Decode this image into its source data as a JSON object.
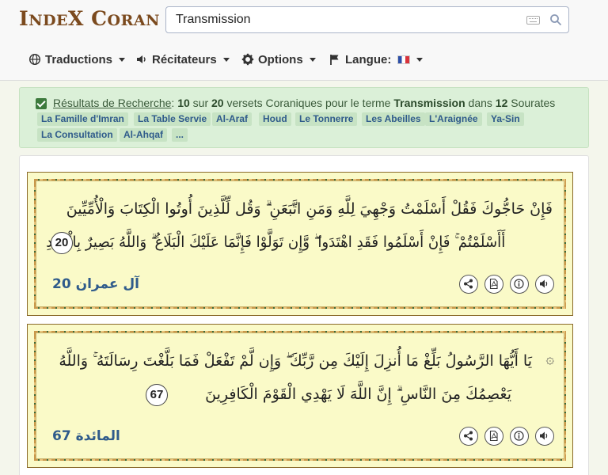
{
  "brand": {
    "logo_text": "INDEX CORAN"
  },
  "search": {
    "value": "Transmission"
  },
  "nav": {
    "translations": "Traductions",
    "reciters": "Récitateurs",
    "options": "Options",
    "language": "Langue:"
  },
  "results": {
    "label": "Résultats de Recherche",
    "colon": ":",
    "count": "10",
    "sur": "sur",
    "total": "20",
    "phrase1": "versets Coraniques pour le terme",
    "term": "Transmission",
    "dans": "dans",
    "sura_count": "12",
    "sourates": "Sourates",
    "tags": [
      "La Famille d'Imran",
      "La Table Servie",
      "Al-Araf",
      "Houd",
      "Le Tonnerre",
      "Les Abeilles",
      "L'Araignée",
      "Ya-Sin",
      "La Consultation",
      "Al-Ahqaf",
      "..."
    ]
  },
  "verses": [
    {
      "line1": "فَإِنْ حَاجُّوكَ فَقُلْ أَسْلَمْتُ وَجْهِيَ لِلَّهِ وَمَنِ اتَّبَعَنِ ۗ وَقُل لِّلَّذِينَ أُوتُوا الْكِتَابَ وَالْأُمِّيِّينَ",
      "line2": "أَأَسْلَمْتُمْ ۚ فَإِنْ أَسْلَمُوا فَقَدِ اهْتَدَوا ۖ وَّإِن تَوَلَّوْا فَإِنَّمَا عَلَيْكَ الْبَلَاغُ ۗ وَاللَّهُ بَصِيرٌ بِالْعِبَادِ",
      "number": "20",
      "reference": "آل عمران 20"
    },
    {
      "line1": "يَا أَيُّهَا الرَّسُولُ بَلِّغْ مَا أُنزِلَ إِلَيْكَ مِن رَّبِّكَ ۖ وَإِن لَّمْ تَفْعَلْ فَمَا بَلَّغْتَ رِسَالَتَهُ ۚ وَاللَّهُ",
      "line2": "يَعْصِمُكَ مِنَ النَّاسِ ۗ إِنَّ اللَّهَ لَا يَهْدِي الْقَوْمَ الْكَافِرِينَ",
      "number": "67",
      "reference": "المائدة 67"
    }
  ]
}
